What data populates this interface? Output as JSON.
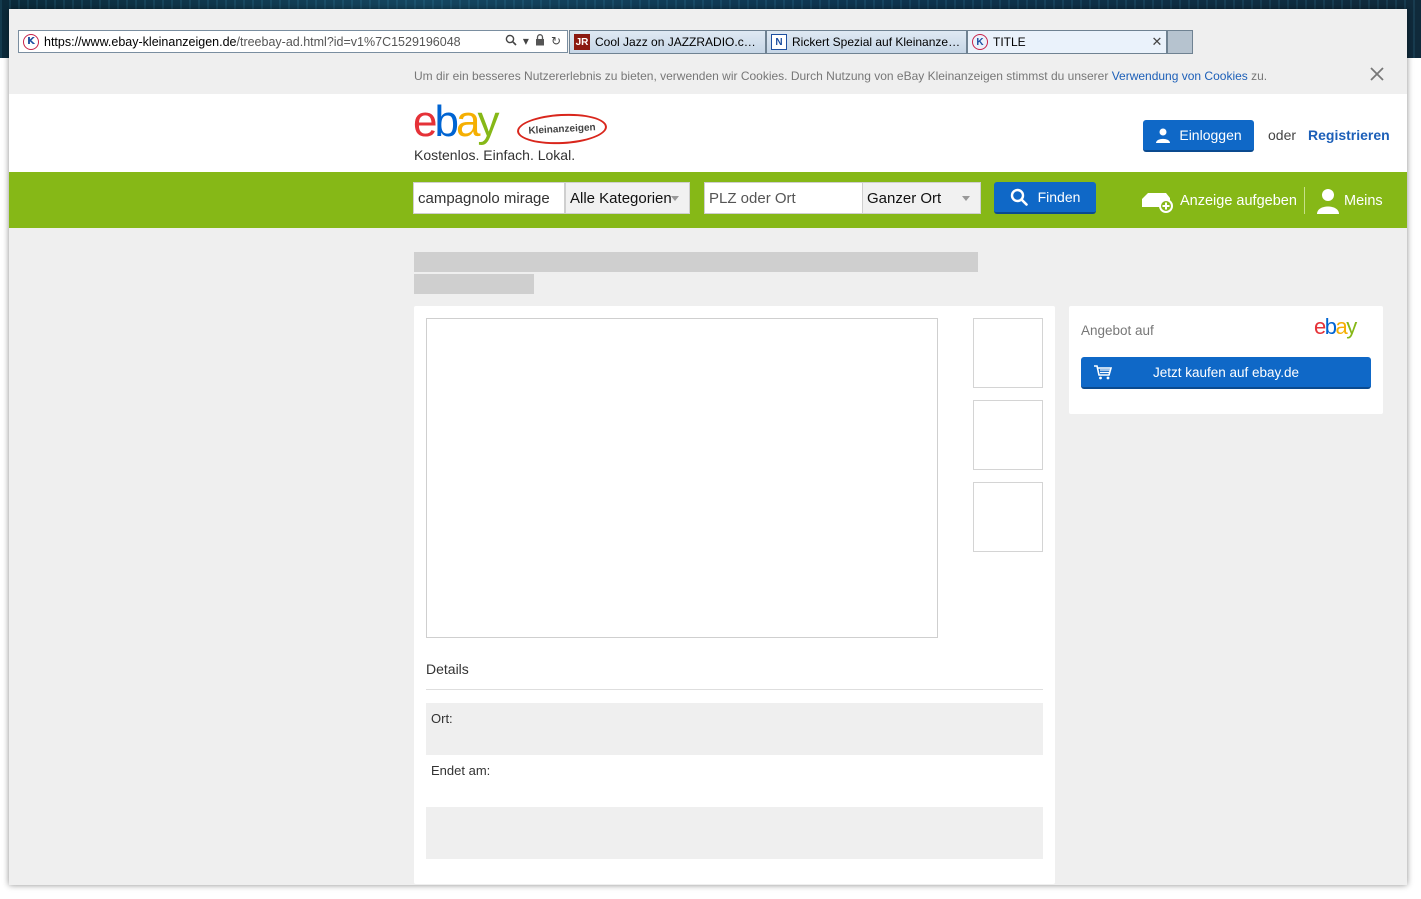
{
  "browser": {
    "address_url_prefix": "https://",
    "address_url_domain": "www.ebay-kleinanzeigen.de",
    "address_url_path": "/treebay-ad.html?id=v1%7C1529196048",
    "tabs": [
      {
        "label": "Cool Jazz on JAZZRADIO.com ...",
        "icon": "JR"
      },
      {
        "label": "Rickert Spezial auf Kleinanzeig...",
        "icon": "N"
      },
      {
        "label": "TITLE",
        "icon": "K"
      }
    ]
  },
  "cookie_bar": {
    "text": "Um dir ein besseres Nutzererlebnis zu bieten, verwenden wir Cookies. Durch Nutzung von eBay Kleinanzeigen stimmst du unserer",
    "link": "Verwendung von Cookies",
    "suffix": "zu."
  },
  "header": {
    "logo_letters": [
      "e",
      "b",
      "a",
      "y"
    ],
    "logo_badge": "Kleinanzeigen",
    "tagline": "Kostenlos. Einfach. Lokal.",
    "login_label": "Einloggen",
    "or_label": "oder",
    "register_label": "Registrieren"
  },
  "search": {
    "query_value": "campagnolo mirage",
    "category_value": "Alle Kategorien",
    "location_placeholder": "PLZ oder Ort",
    "radius_value": "Ganzer Ort",
    "find_label": "Finden",
    "post_ad_label": "Anzeige aufgeben",
    "my_label": "Meins"
  },
  "listing": {
    "details_title": "Details",
    "location_label": "Ort:",
    "ends_label": "Endet am:"
  },
  "offer": {
    "title": "Angebot auf",
    "buy_label": "Jetzt kaufen auf ebay.de"
  },
  "colors": {
    "brand_green": "#86b817",
    "button_blue": "#0f68c7",
    "link_blue": "#1c5fb8",
    "ebay_red": "#e53238",
    "ebay_blue": "#0064d2",
    "ebay_yellow": "#f5af02"
  },
  "icons": [
    "site-k-icon",
    "search-icon",
    "dropdown-icon",
    "lock-icon",
    "refresh-icon",
    "close-icon",
    "user-icon",
    "chevron-down-icon",
    "post-ad-icon",
    "shopping-cart-icon"
  ]
}
